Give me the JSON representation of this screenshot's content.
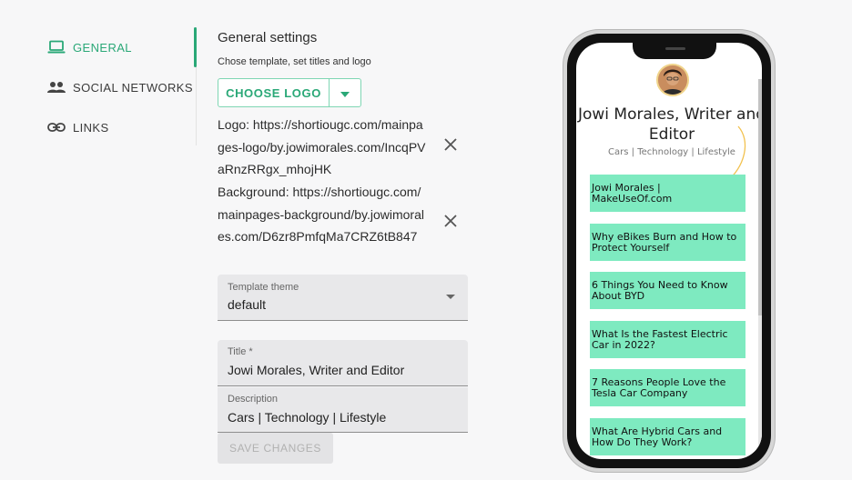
{
  "nav": {
    "items": [
      {
        "label": "GENERAL",
        "icon": "laptop-icon",
        "active": true
      },
      {
        "label": "SOCIAL NETWORKS",
        "icon": "people-icon",
        "active": false
      },
      {
        "label": "LINKS",
        "icon": "link-icon",
        "active": false
      }
    ]
  },
  "settings": {
    "title": "General settings",
    "subtitle": "Chose template, set titles and logo",
    "choose_logo_label": "CHOOSE LOGO",
    "logo_text": "Logo: https://shortiougc.com/mainpages-logo/by.jowimorales.com/IncqPVaRnzRRgx_mhojHK",
    "background_text": "Background: https://shortiougc.com/mainpages-background/by.jowimorales.com/D6zr8PmfqMa7CRZ6tB847",
    "template_theme": {
      "label": "Template theme",
      "value": "default"
    },
    "title_field": {
      "label": "Title *",
      "value": "Jowi Morales, Writer and Editor"
    },
    "description_field": {
      "label": "Description",
      "value": "Cars | Technology | Lifestyle"
    },
    "save_label": "SAVE CHANGES"
  },
  "preview": {
    "name": "Jowi Morales, Writer and Editor",
    "description": "Cars | Technology | Lifestyle",
    "links": [
      "Jowi Morales | MakeUseOf.com",
      "Why eBikes Burn and How to Protect Yourself",
      "6 Things You Need to Know About BYD",
      "What Is the Fastest Electric Car in 2022?",
      "7 Reasons People Love the Tesla Car Company",
      "What Are Hybrid Cars and How Do They Work?"
    ]
  },
  "colors": {
    "accent": "#2aa877",
    "link_card": "#7eeac0",
    "arrow": "#f2c14e"
  }
}
